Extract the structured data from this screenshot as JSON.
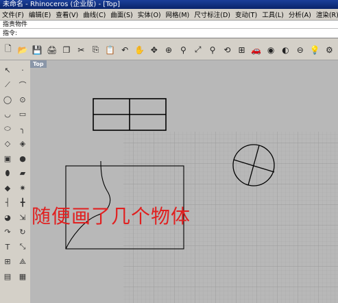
{
  "title": "未命名 - Rhinoceros (企业版) - [Top]",
  "menu": [
    "文件(F)",
    "编辑(E)",
    "查看(V)",
    "曲线(C)",
    "曲面(S)",
    "实体(O)",
    "网格(M)",
    "尺寸标注(D)",
    "变动(T)",
    "工具(L)",
    "分析(A)",
    "渲染(R)",
    "说"
  ],
  "command_history": "指责物件",
  "command_prompt": "指令:",
  "command_value": "",
  "viewport_label": "Top",
  "caption": "随便画了几个物体",
  "toolbar_icons": [
    "new-icon",
    "open-icon",
    "save-icon",
    "print-icon",
    "copy-icon",
    "cut-icon",
    "paste-icon",
    "clipboard-icon",
    "undo-icon",
    "pan-icon",
    "rotate-icon",
    "zoom-window-icon",
    "zoom-dynamic-icon",
    "zoom-extents-icon",
    "zoom-selected-icon",
    "rotate-view-icon",
    "grid-icon",
    "car-icon",
    "shade-icon",
    "render-icon",
    "view-icon",
    "light-icon",
    "settings-icon"
  ],
  "toolbar_glyphs": [
    "🗋",
    "📂",
    "💾",
    "🖨",
    "❐",
    "✂",
    "⎘",
    "📋",
    "↶",
    "✋",
    "✥",
    "⊕",
    "⚲",
    "⤢",
    "⚲",
    "⟲",
    "⊞",
    "🚗",
    "◉",
    "◐",
    "⊖",
    "💡",
    "⚙"
  ],
  "left_tools": [
    [
      "select-icon",
      "↖"
    ],
    [
      "point-icon",
      "·"
    ],
    [
      "polyline-icon",
      "⟋"
    ],
    [
      "curve-icon",
      "⌒"
    ],
    [
      "circle-icon",
      "◯"
    ],
    [
      "circle-3pt-icon",
      "⊙"
    ],
    [
      "arc-icon",
      "◡"
    ],
    [
      "rectangle-icon",
      "▭"
    ],
    [
      "ellipse-icon",
      "⬭"
    ],
    [
      "fillet-icon",
      "╮"
    ],
    [
      "surface-icon",
      "◇"
    ],
    [
      "sweep-icon",
      "◈"
    ],
    [
      "box-icon",
      "▣"
    ],
    [
      "sphere-icon",
      "●"
    ],
    [
      "cylinder-icon",
      "⬮"
    ],
    [
      "plane-icon",
      "▰"
    ],
    [
      "boolean-icon",
      "◆"
    ],
    [
      "explode-icon",
      "✷"
    ],
    [
      "join-icon",
      "┤"
    ],
    [
      "split-icon",
      "╋"
    ],
    [
      "mesh-icon",
      "◕"
    ],
    [
      "transform-icon",
      "⇲"
    ],
    [
      "mirror-icon",
      "↷"
    ],
    [
      "rotate-icon",
      "↻"
    ],
    [
      "dimension-icon",
      "T"
    ],
    [
      "scale-icon",
      "⤡"
    ],
    [
      "array-icon",
      "⊞"
    ],
    [
      "text-icon",
      "⟁"
    ],
    [
      "layer-icon",
      "▤"
    ],
    [
      "properties-icon",
      "▦"
    ]
  ]
}
